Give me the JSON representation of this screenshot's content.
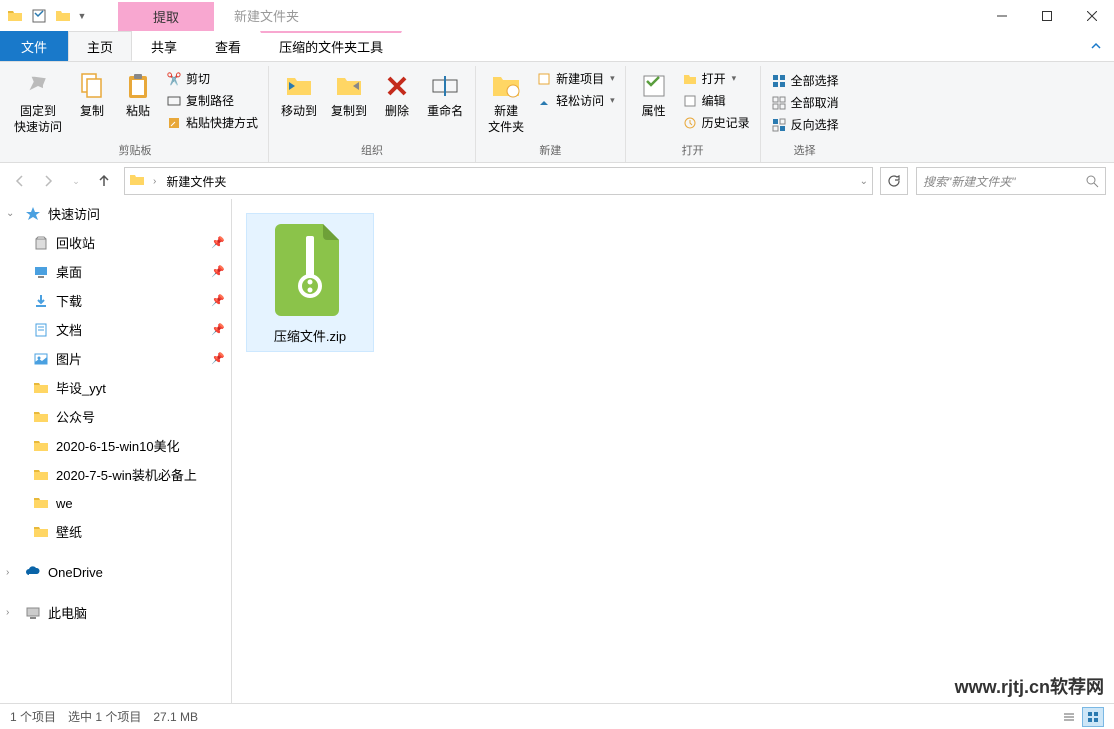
{
  "window": {
    "context_tab": "提取",
    "title": "新建文件夹"
  },
  "tabs": {
    "file": "文件",
    "home": "主页",
    "share": "共享",
    "view": "查看",
    "compressed": "压缩的文件夹工具"
  },
  "ribbon": {
    "pin": "固定到\n快速访问",
    "copy": "复制",
    "paste": "粘贴",
    "cut": "剪切",
    "copy_path": "复制路径",
    "paste_shortcut": "粘贴快捷方式",
    "clipboard_group": "剪贴板",
    "move_to": "移动到",
    "copy_to": "复制到",
    "delete": "删除",
    "rename": "重命名",
    "organize_group": "组织",
    "new_folder": "新建\n文件夹",
    "new_item": "新建项目",
    "easy_access": "轻松访问",
    "new_group": "新建",
    "properties": "属性",
    "open": "打开",
    "edit": "编辑",
    "history": "历史记录",
    "open_group": "打开",
    "select_all": "全部选择",
    "select_none": "全部取消",
    "invert_selection": "反向选择",
    "select_group": "选择"
  },
  "breadcrumb": {
    "current": "新建文件夹"
  },
  "search": {
    "placeholder": "搜索\"新建文件夹\""
  },
  "sidebar": {
    "quick_access": "快速访问",
    "items": [
      {
        "label": "回收站",
        "pinned": true
      },
      {
        "label": "桌面",
        "pinned": true
      },
      {
        "label": "下载",
        "pinned": true
      },
      {
        "label": "文档",
        "pinned": true
      },
      {
        "label": "图片",
        "pinned": true
      },
      {
        "label": "毕设_yyt",
        "pinned": false
      },
      {
        "label": "公众号",
        "pinned": false
      },
      {
        "label": "2020-6-15-win10美化",
        "pinned": false
      },
      {
        "label": "2020-7-5-win装机必备上",
        "pinned": false
      },
      {
        "label": "we",
        "pinned": false
      },
      {
        "label": "壁纸",
        "pinned": false
      }
    ],
    "onedrive": "OneDrive",
    "this_pc": "此电脑"
  },
  "files": [
    {
      "name": "压缩文件.zip"
    }
  ],
  "status": {
    "count": "1 个项目",
    "selected": "选中 1 个项目",
    "size": "27.1 MB"
  },
  "watermark": "www.rjtj.cn软荐网"
}
